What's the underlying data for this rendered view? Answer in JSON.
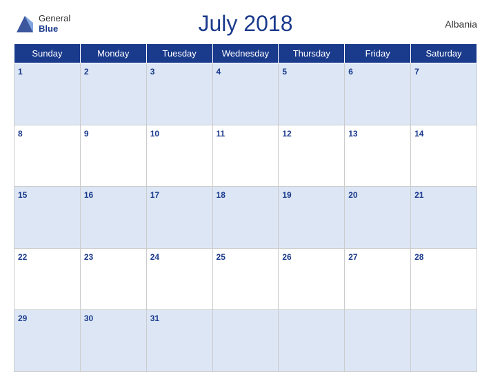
{
  "header": {
    "logo_general": "General",
    "logo_blue": "Blue",
    "title": "July 2018",
    "country": "Albania"
  },
  "days_of_week": [
    "Sunday",
    "Monday",
    "Tuesday",
    "Wednesday",
    "Thursday",
    "Friday",
    "Saturday"
  ],
  "weeks": [
    [
      {
        "day": 1,
        "empty": false
      },
      {
        "day": 2,
        "empty": false
      },
      {
        "day": 3,
        "empty": false
      },
      {
        "day": 4,
        "empty": false
      },
      {
        "day": 5,
        "empty": false
      },
      {
        "day": 6,
        "empty": false
      },
      {
        "day": 7,
        "empty": false
      }
    ],
    [
      {
        "day": 8,
        "empty": false
      },
      {
        "day": 9,
        "empty": false
      },
      {
        "day": 10,
        "empty": false
      },
      {
        "day": 11,
        "empty": false
      },
      {
        "day": 12,
        "empty": false
      },
      {
        "day": 13,
        "empty": false
      },
      {
        "day": 14,
        "empty": false
      }
    ],
    [
      {
        "day": 15,
        "empty": false
      },
      {
        "day": 16,
        "empty": false
      },
      {
        "day": 17,
        "empty": false
      },
      {
        "day": 18,
        "empty": false
      },
      {
        "day": 19,
        "empty": false
      },
      {
        "day": 20,
        "empty": false
      },
      {
        "day": 21,
        "empty": false
      }
    ],
    [
      {
        "day": 22,
        "empty": false
      },
      {
        "day": 23,
        "empty": false
      },
      {
        "day": 24,
        "empty": false
      },
      {
        "day": 25,
        "empty": false
      },
      {
        "day": 26,
        "empty": false
      },
      {
        "day": 27,
        "empty": false
      },
      {
        "day": 28,
        "empty": false
      }
    ],
    [
      {
        "day": 29,
        "empty": false
      },
      {
        "day": 30,
        "empty": false
      },
      {
        "day": 31,
        "empty": false
      },
      {
        "day": null,
        "empty": true
      },
      {
        "day": null,
        "empty": true
      },
      {
        "day": null,
        "empty": true
      },
      {
        "day": null,
        "empty": true
      }
    ]
  ]
}
